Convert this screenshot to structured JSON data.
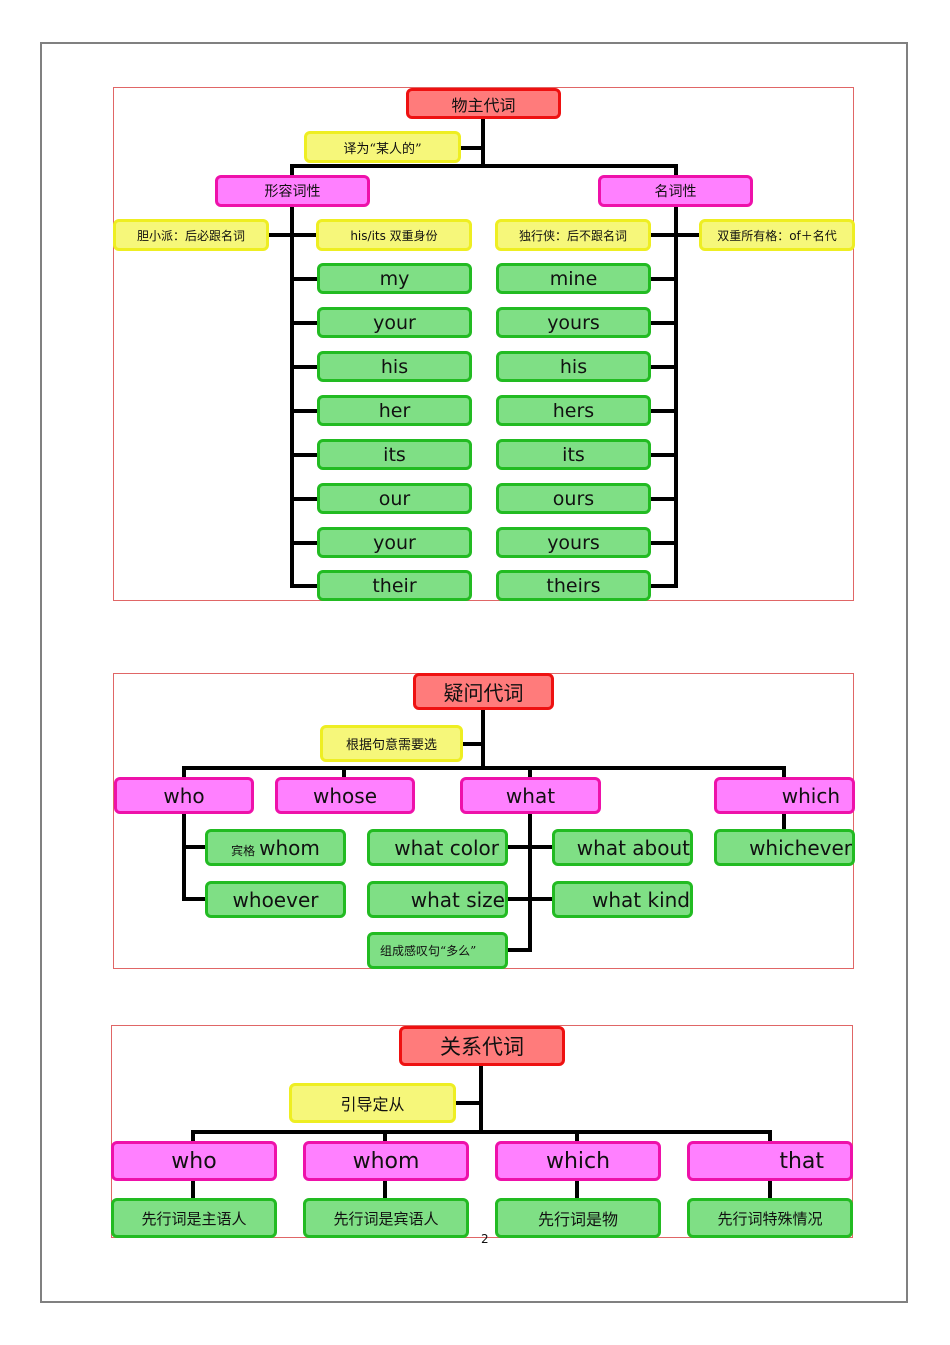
{
  "page_number": "2",
  "diagram1": {
    "title": "物主代词",
    "note": "译为“某人的”",
    "adjective": {
      "label": "形容词性",
      "left_note": "胆小派：后必跟名词",
      "right_note": "his/its  双重身份",
      "items": [
        "my",
        "your",
        "his",
        "her",
        "its",
        "our",
        "your",
        "their"
      ]
    },
    "noun": {
      "label": "名词性",
      "left_note": "独行侠：后不跟名词",
      "right_note": "双重所有格：of＋名代",
      "items": [
        "mine",
        "yours",
        "his",
        "hers",
        "its",
        "ours",
        "yours",
        "theirs"
      ]
    }
  },
  "diagram2": {
    "title": "疑问代词",
    "note": "根据句意需要选",
    "branches": [
      {
        "label": "who",
        "children": [
          {
            "prefix": "宾格",
            "text": "whom"
          },
          {
            "prefix": "",
            "text": "whoever"
          }
        ]
      },
      {
        "label": "whose",
        "children": [
          {
            "prefix": "",
            "text": "what color"
          },
          {
            "prefix": "",
            "text": "what size"
          },
          {
            "prefix": "",
            "text": "组成感叹句“多么”"
          }
        ]
      },
      {
        "label": "what",
        "children": [
          {
            "prefix": "",
            "text": "what about"
          },
          {
            "prefix": "",
            "text": "what kind"
          }
        ]
      },
      {
        "label": "which",
        "children": [
          {
            "prefix": "",
            "text": "whichever"
          }
        ]
      }
    ]
  },
  "diagram3": {
    "title": "关系代词",
    "note": "引导定从",
    "branches": [
      {
        "label": "who",
        "child": "先行词是主语人"
      },
      {
        "label": "whom",
        "child": "先行词是宾语人"
      },
      {
        "label": "which",
        "child": "先行词是物"
      },
      {
        "label": "that",
        "child": "先行词特殊情况"
      }
    ]
  },
  "colors": {
    "root_fill": "#ff7b7b",
    "root_border": "#ee1111",
    "category_fill": "#ff80ff",
    "category_border": "#ee11aa",
    "note_fill": "#f6f77a",
    "note_border": "#eeee22",
    "leaf_fill": "#7fdf85",
    "leaf_border": "#22bb22",
    "frame": "#e06666",
    "connector": "#000000"
  }
}
